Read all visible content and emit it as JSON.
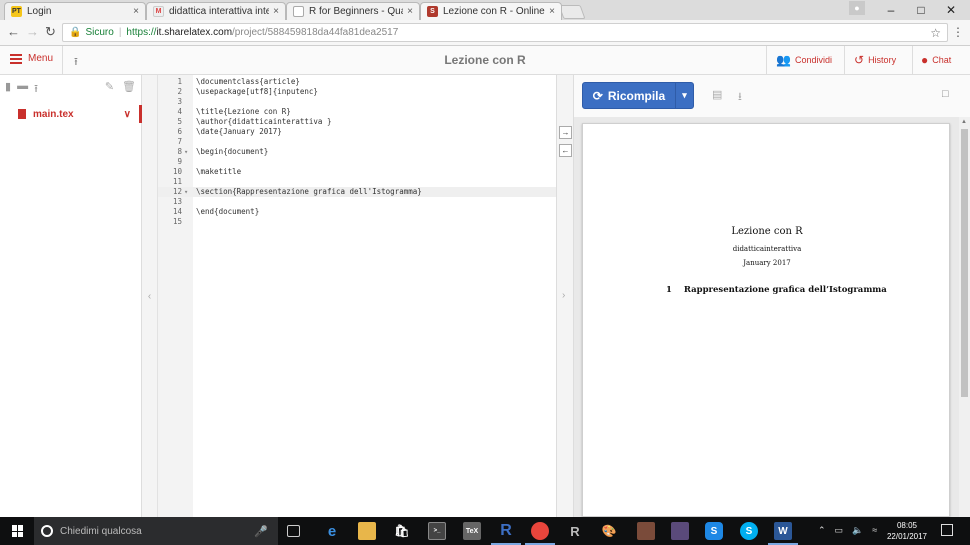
{
  "browser": {
    "tabs": [
      {
        "label": "Login",
        "icon": "pt-favicon",
        "color": "#f5c518"
      },
      {
        "label": "didattica interattiva inte",
        "icon": "gmail-favicon",
        "color": "#d9d9d9"
      },
      {
        "label": "R for Beginners - Quanta",
        "icon": "page-favicon",
        "color": "#ffffff"
      },
      {
        "label": "Lezione con R - Online L",
        "icon": "sharelatex-favicon",
        "color": "#b03a2e"
      }
    ],
    "close_glyph": "×",
    "secure_label": "Sicuro",
    "url_proto": "https://",
    "url_host": "it.sharelatex.com",
    "url_path": "/project/588459818da44fa81dea2517"
  },
  "header": {
    "menu_label": "Menu",
    "project_title": "Lezione con R",
    "share_label": "Condividi",
    "history_label": "History",
    "chat_label": "Chat",
    "accent": "#c9302c"
  },
  "file_tree": {
    "files": [
      {
        "name": "main.tex"
      }
    ]
  },
  "editor": {
    "lines": [
      {
        "n": "1",
        "text": "\\documentclass{article}"
      },
      {
        "n": "2",
        "text": "\\usepackage[utf8]{inputenc}"
      },
      {
        "n": "3",
        "text": ""
      },
      {
        "n": "4",
        "text": "\\title{Lezione con R}"
      },
      {
        "n": "5",
        "text": "\\author{didatticainterattiva }"
      },
      {
        "n": "6",
        "text": "\\date{January 2017}"
      },
      {
        "n": "7",
        "text": ""
      },
      {
        "n": "8",
        "text": "\\begin{document}",
        "fold": true
      },
      {
        "n": "9",
        "text": ""
      },
      {
        "n": "10",
        "text": "\\maketitle"
      },
      {
        "n": "11",
        "text": ""
      },
      {
        "n": "12",
        "text": "\\section{Rappresentazione grafica dell'Istogramma}",
        "fold": true,
        "active": true
      },
      {
        "n": "13",
        "text": ""
      },
      {
        "n": "14",
        "text": "\\end{document}"
      },
      {
        "n": "15",
        "text": ""
      }
    ]
  },
  "pdf": {
    "recompile_label": "Ricompila",
    "button_color": "#3c6fc3",
    "title": "Lezione con R",
    "author": "didatticainterattiva",
    "date": "January 2017",
    "section_number": "1",
    "section_title": "Rappresentazione grafica dell’Istogramma"
  },
  "taskbar": {
    "search_placeholder": "Chiedimi qualcosa",
    "time": "08:05",
    "date": "22/01/2017"
  }
}
